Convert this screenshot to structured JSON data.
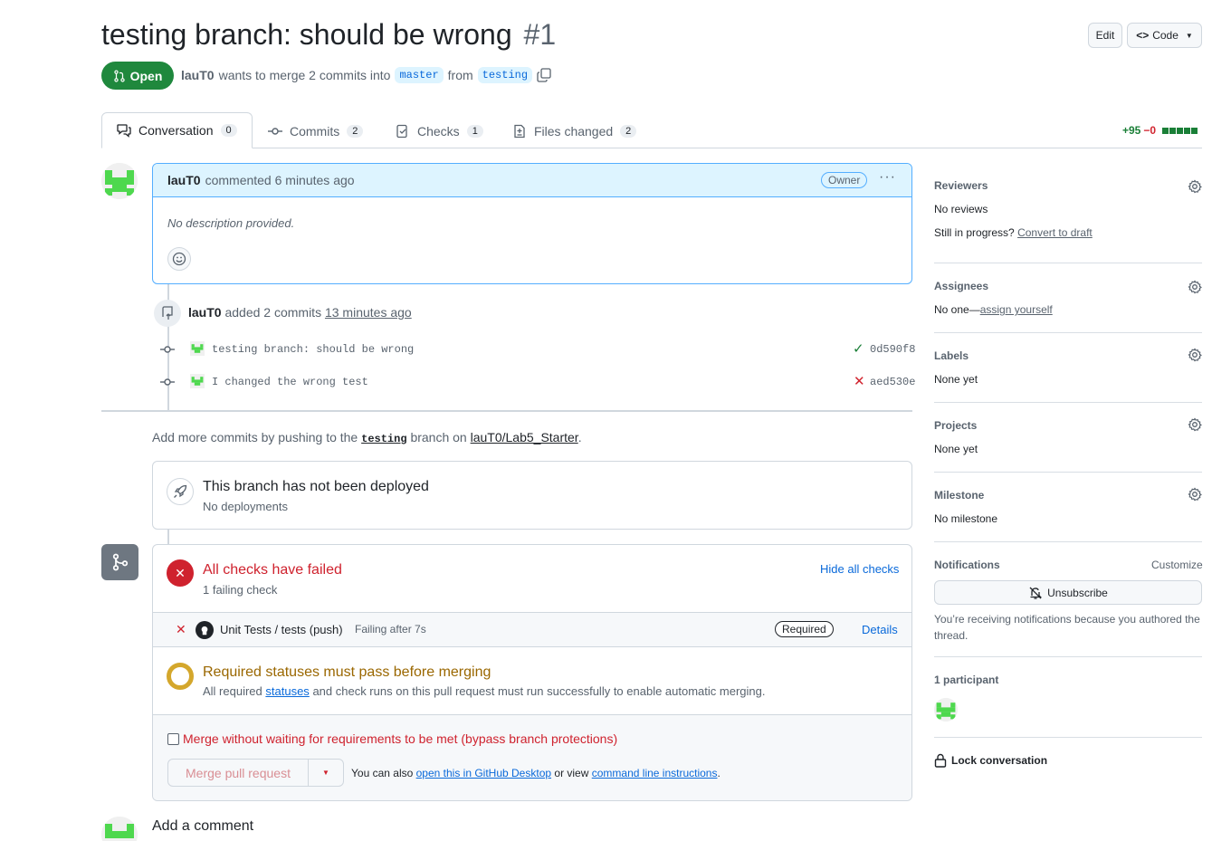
{
  "header": {
    "title": "testing branch: should be wrong",
    "number": "#1",
    "edit_label": "Edit",
    "code_label": "Code",
    "state_label": "Open",
    "author": "lauT0",
    "merge_text": "wants to merge 2 commits into",
    "base_branch": "master",
    "from_text": "from",
    "head_branch": "testing"
  },
  "tabs": [
    {
      "label": "Conversation",
      "count": "0"
    },
    {
      "label": "Commits",
      "count": "2"
    },
    {
      "label": "Checks",
      "count": "1"
    },
    {
      "label": "Files changed",
      "count": "2"
    }
  ],
  "diffstat": {
    "additions": "+95",
    "deletions": "−0"
  },
  "comment": {
    "author": "lauT0",
    "meta": "commented 6 minutes ago",
    "badge": "Owner",
    "body": "No description provided."
  },
  "commits_event": {
    "author": "lauT0",
    "text": "added 2 commits",
    "time": "13 minutes ago",
    "commits": [
      {
        "message": "testing branch: should be wrong",
        "sha": "0d590f8",
        "status": "success"
      },
      {
        "message": "I changed the wrong test",
        "sha": "aed530e",
        "status": "failure"
      }
    ]
  },
  "push_hint": {
    "prefix": "Add more commits by pushing to the",
    "branch": "testing",
    "middle": "branch on",
    "repo": "lauT0/Lab5_Starter",
    "suffix": "."
  },
  "deploy": {
    "title": "This branch has not been deployed",
    "subtitle": "No deployments"
  },
  "checks": {
    "title": "All checks have failed",
    "subtitle": "1 failing check",
    "hide_label": "Hide all checks",
    "check_name": "Unit Tests / tests (push)",
    "check_status": "Failing after 7s",
    "required_label": "Required",
    "details_label": "Details",
    "req_title": "Required statuses must pass before merging",
    "req_prefix": "All required",
    "req_link": "statuses",
    "req_suffix": "and check runs on this pull request must run successfully to enable automatic merging.",
    "bypass_label": "Merge without waiting for requirements to be met (bypass branch protections)",
    "merge_label": "Merge pull request",
    "also_prefix": "You can also",
    "desktop_link": "open this in GitHub Desktop",
    "or_view": "or view",
    "cli_link": "command line instructions",
    "cli_suffix": "."
  },
  "add_comment_label": "Add a comment",
  "sidebar": {
    "reviewers": {
      "heading": "Reviewers",
      "value": "No reviews",
      "progress_prefix": "Still in progress?",
      "progress_link": "Convert to draft"
    },
    "assignees": {
      "heading": "Assignees",
      "prefix": "No one—",
      "link": "assign yourself"
    },
    "labels": {
      "heading": "Labels",
      "value": "None yet"
    },
    "projects": {
      "heading": "Projects",
      "value": "None yet"
    },
    "milestone": {
      "heading": "Milestone",
      "value": "No milestone"
    },
    "notifications": {
      "heading": "Notifications",
      "customize": "Customize",
      "button": "Unsubscribe",
      "note": "You’re receiving notifications because you authored the thread."
    },
    "participants": {
      "heading": "1 participant"
    },
    "lock": "Lock conversation"
  },
  "colors": {
    "open": "#1f883d",
    "danger": "#cf222e",
    "attention": "#9a6700",
    "accent": "#0969da",
    "muted": "#59636e"
  }
}
